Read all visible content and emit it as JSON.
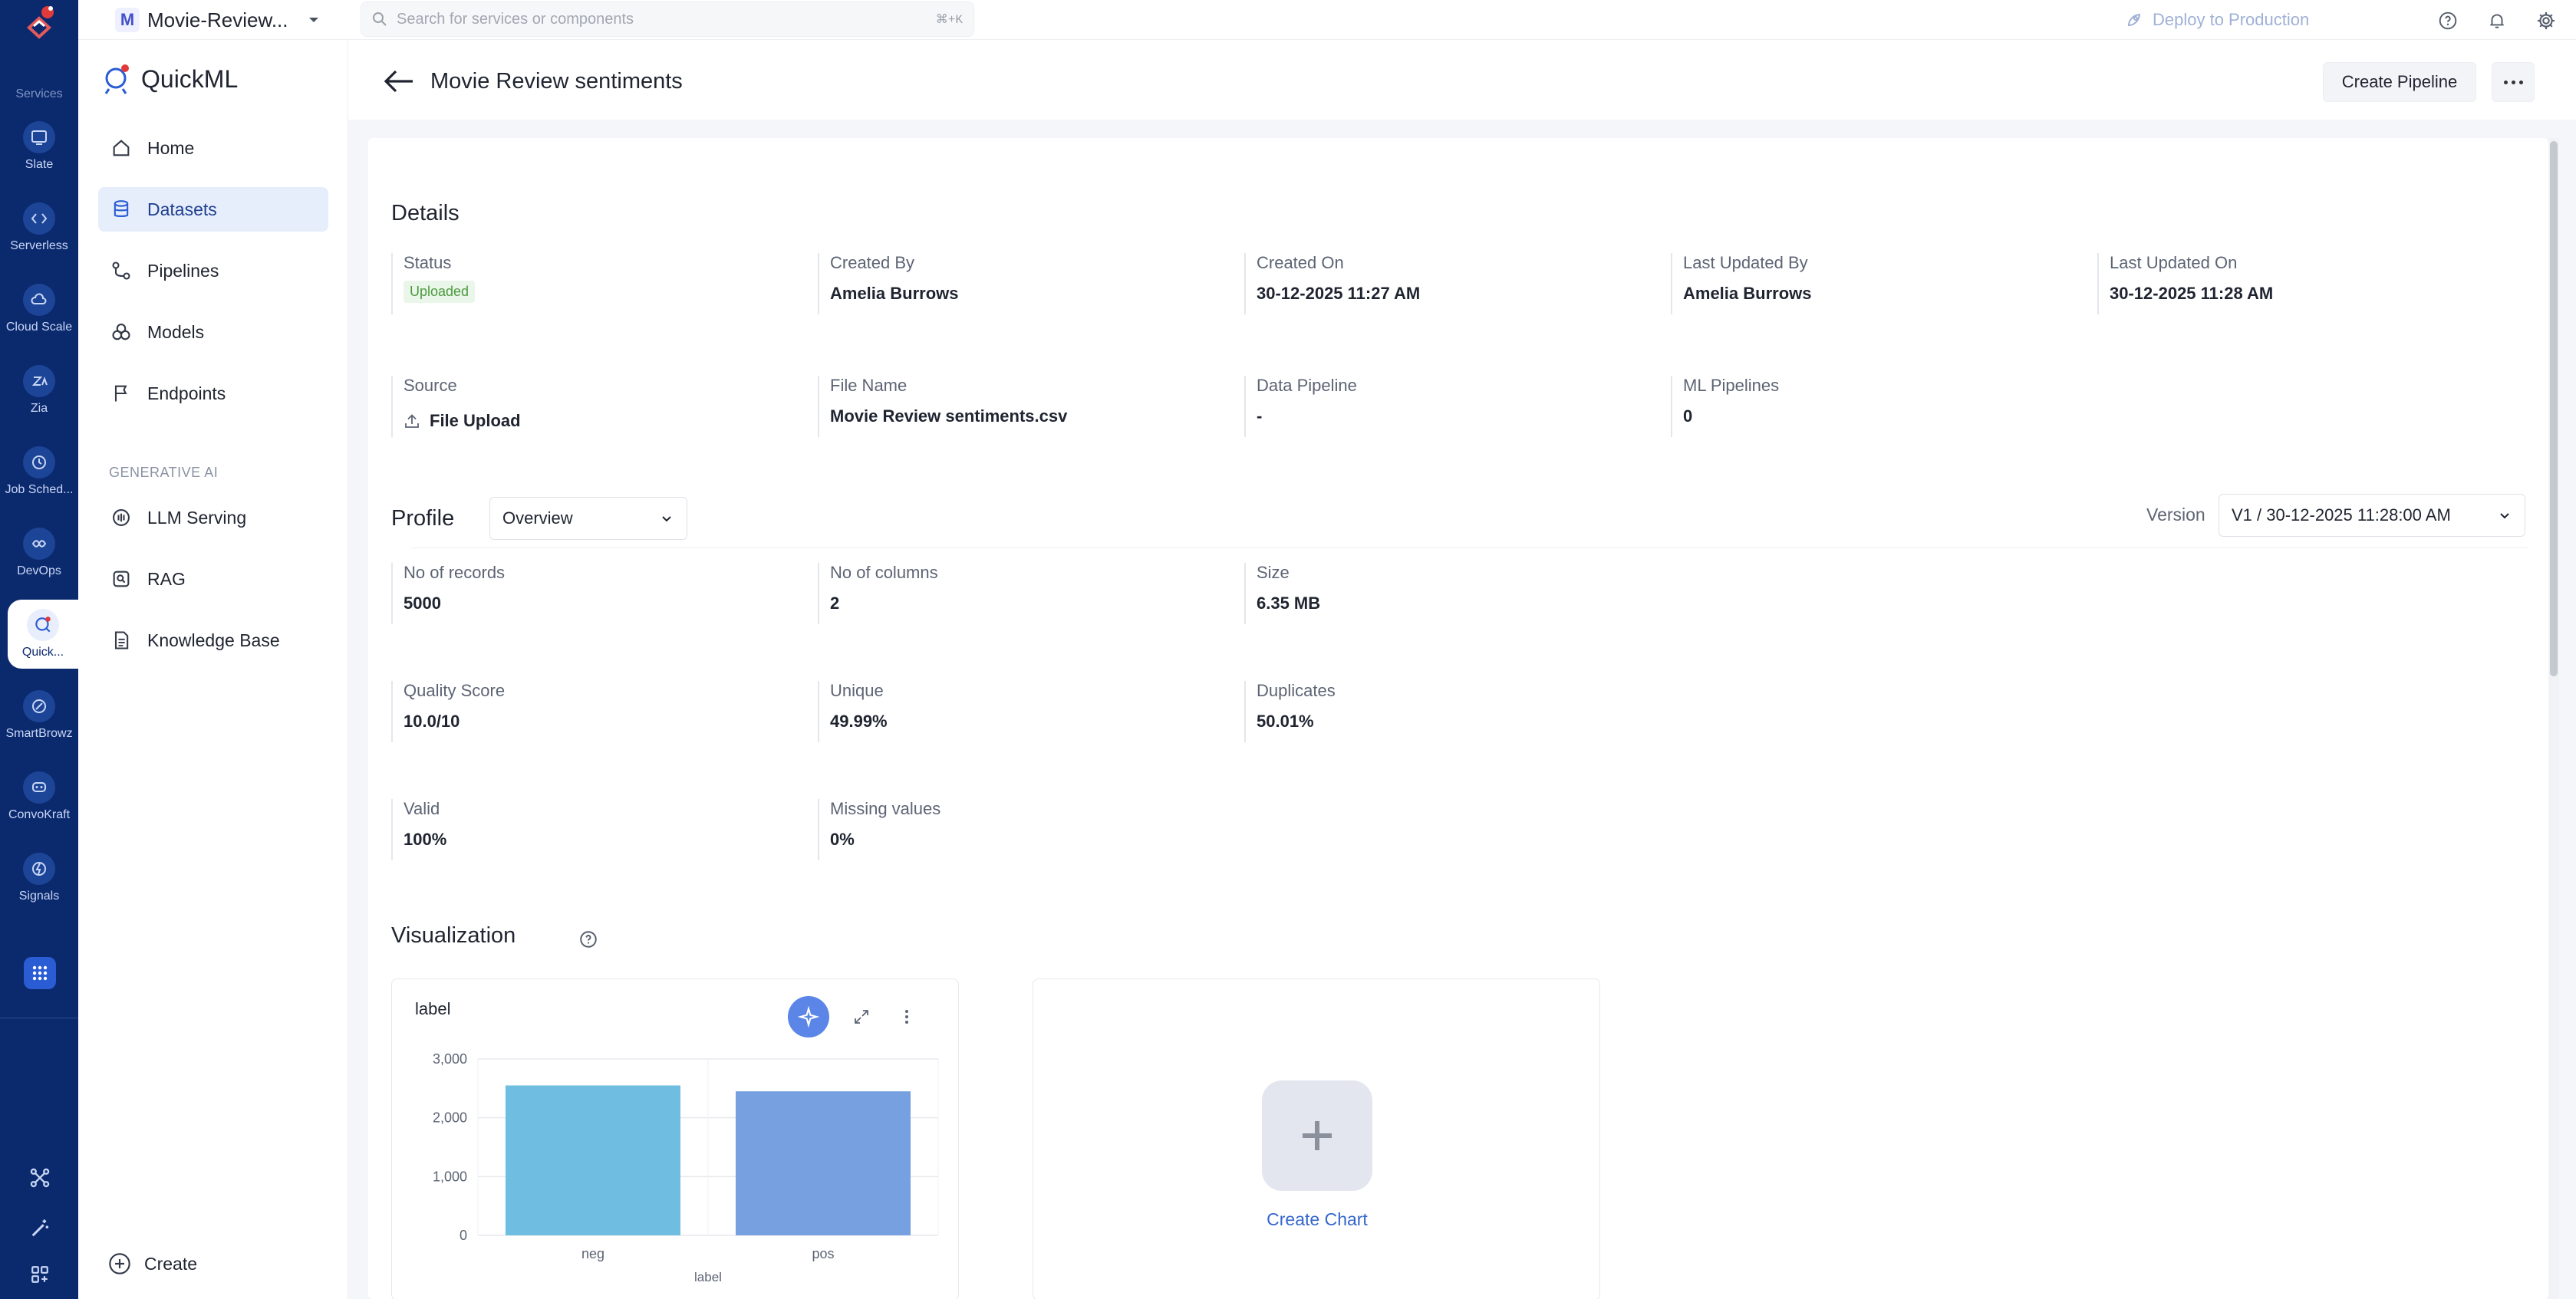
{
  "rail": {
    "items": [
      {
        "label": "Services",
        "icon": "services-icon"
      },
      {
        "label": "Slate",
        "icon": "slate-icon"
      },
      {
        "label": "Serverless",
        "icon": "serverless-icon"
      },
      {
        "label": "Cloud Scale",
        "icon": "cloud-scale-icon"
      },
      {
        "label": "Zia",
        "icon": "zia-icon"
      },
      {
        "label": "Job Sched...",
        "icon": "job-scheduler-icon"
      },
      {
        "label": "DevOps",
        "icon": "devops-icon"
      },
      {
        "label": "Quick...",
        "icon": "quickml-icon"
      },
      {
        "label": "SmartBrowz",
        "icon": "smartbrowz-icon"
      },
      {
        "label": "ConvoKraft",
        "icon": "convokraft-icon"
      },
      {
        "label": "Signals",
        "icon": "signals-icon"
      }
    ]
  },
  "topbar": {
    "project_initial": "M",
    "project_name": "Movie-Review...",
    "search_placeholder": "Search for services or components",
    "shortcut": "⌘+K",
    "deploy_label": "Deploy to Production"
  },
  "sidenav": {
    "brand": "QuickML",
    "items": [
      {
        "label": "Home"
      },
      {
        "label": "Datasets"
      },
      {
        "label": "Pipelines"
      },
      {
        "label": "Models"
      },
      {
        "label": "Endpoints"
      }
    ],
    "section_label": "GENERATIVE AI",
    "gen_items": [
      {
        "label": "LLM Serving"
      },
      {
        "label": "RAG"
      },
      {
        "label": "Knowledge Base"
      }
    ],
    "create_label": "Create"
  },
  "header": {
    "title": "Movie Review sentiments",
    "create_pipeline_label": "Create Pipeline"
  },
  "details": {
    "title": "Details",
    "status_label": "Status",
    "status_value": "Uploaded",
    "created_by_label": "Created By",
    "created_by_value": "Amelia Burrows",
    "created_on_label": "Created On",
    "created_on_value": "30-12-2025 11:27 AM",
    "updated_by_label": "Last Updated By",
    "updated_by_value": "Amelia Burrows",
    "updated_on_label": "Last Updated On",
    "updated_on_value": "30-12-2025 11:28 AM",
    "source_label": "Source",
    "source_value": "File Upload",
    "file_name_label": "File Name",
    "file_name_value": "Movie Review sentiments.csv",
    "data_pipeline_label": "Data Pipeline",
    "data_pipeline_value": "-",
    "ml_pipelines_label": "ML Pipelines",
    "ml_pipelines_value": "0"
  },
  "profile": {
    "title": "Profile",
    "view_selected": "Overview",
    "version_label": "Version",
    "version_selected": "V1 / 30-12-2025 11:28:00 AM",
    "records_label": "No of records",
    "records_value": "5000",
    "columns_label": "No of columns",
    "columns_value": "2",
    "size_label": "Size",
    "size_value": "6.35 MB",
    "quality_label": "Quality Score",
    "quality_value": "10.0/10",
    "unique_label": "Unique",
    "unique_value": "49.99%",
    "duplicates_label": "Duplicates",
    "duplicates_value": "50.01%",
    "valid_label": "Valid",
    "valid_value": "100%",
    "missing_label": "Missing values",
    "missing_value": "0%"
  },
  "visualization": {
    "title": "Visualization",
    "create_chart_label": "Create Chart"
  },
  "colors": {
    "rail_bg": "#0b2a6e",
    "accent": "#3366cc",
    "bar_neg": "#6fbde0",
    "bar_pos": "#77a0e0",
    "uploaded_text": "#4a9a3e"
  },
  "chart_data": {
    "type": "bar",
    "title": "label",
    "xlabel": "label",
    "ylabel": "",
    "categories": [
      "neg",
      "pos"
    ],
    "values": [
      2550,
      2450
    ],
    "ylim": [
      0,
      3000
    ],
    "yticks": [
      0,
      1000,
      2000,
      3000
    ],
    "ytick_labels": [
      "0",
      "1,000",
      "2,000",
      "3,000"
    ],
    "grid": true
  }
}
